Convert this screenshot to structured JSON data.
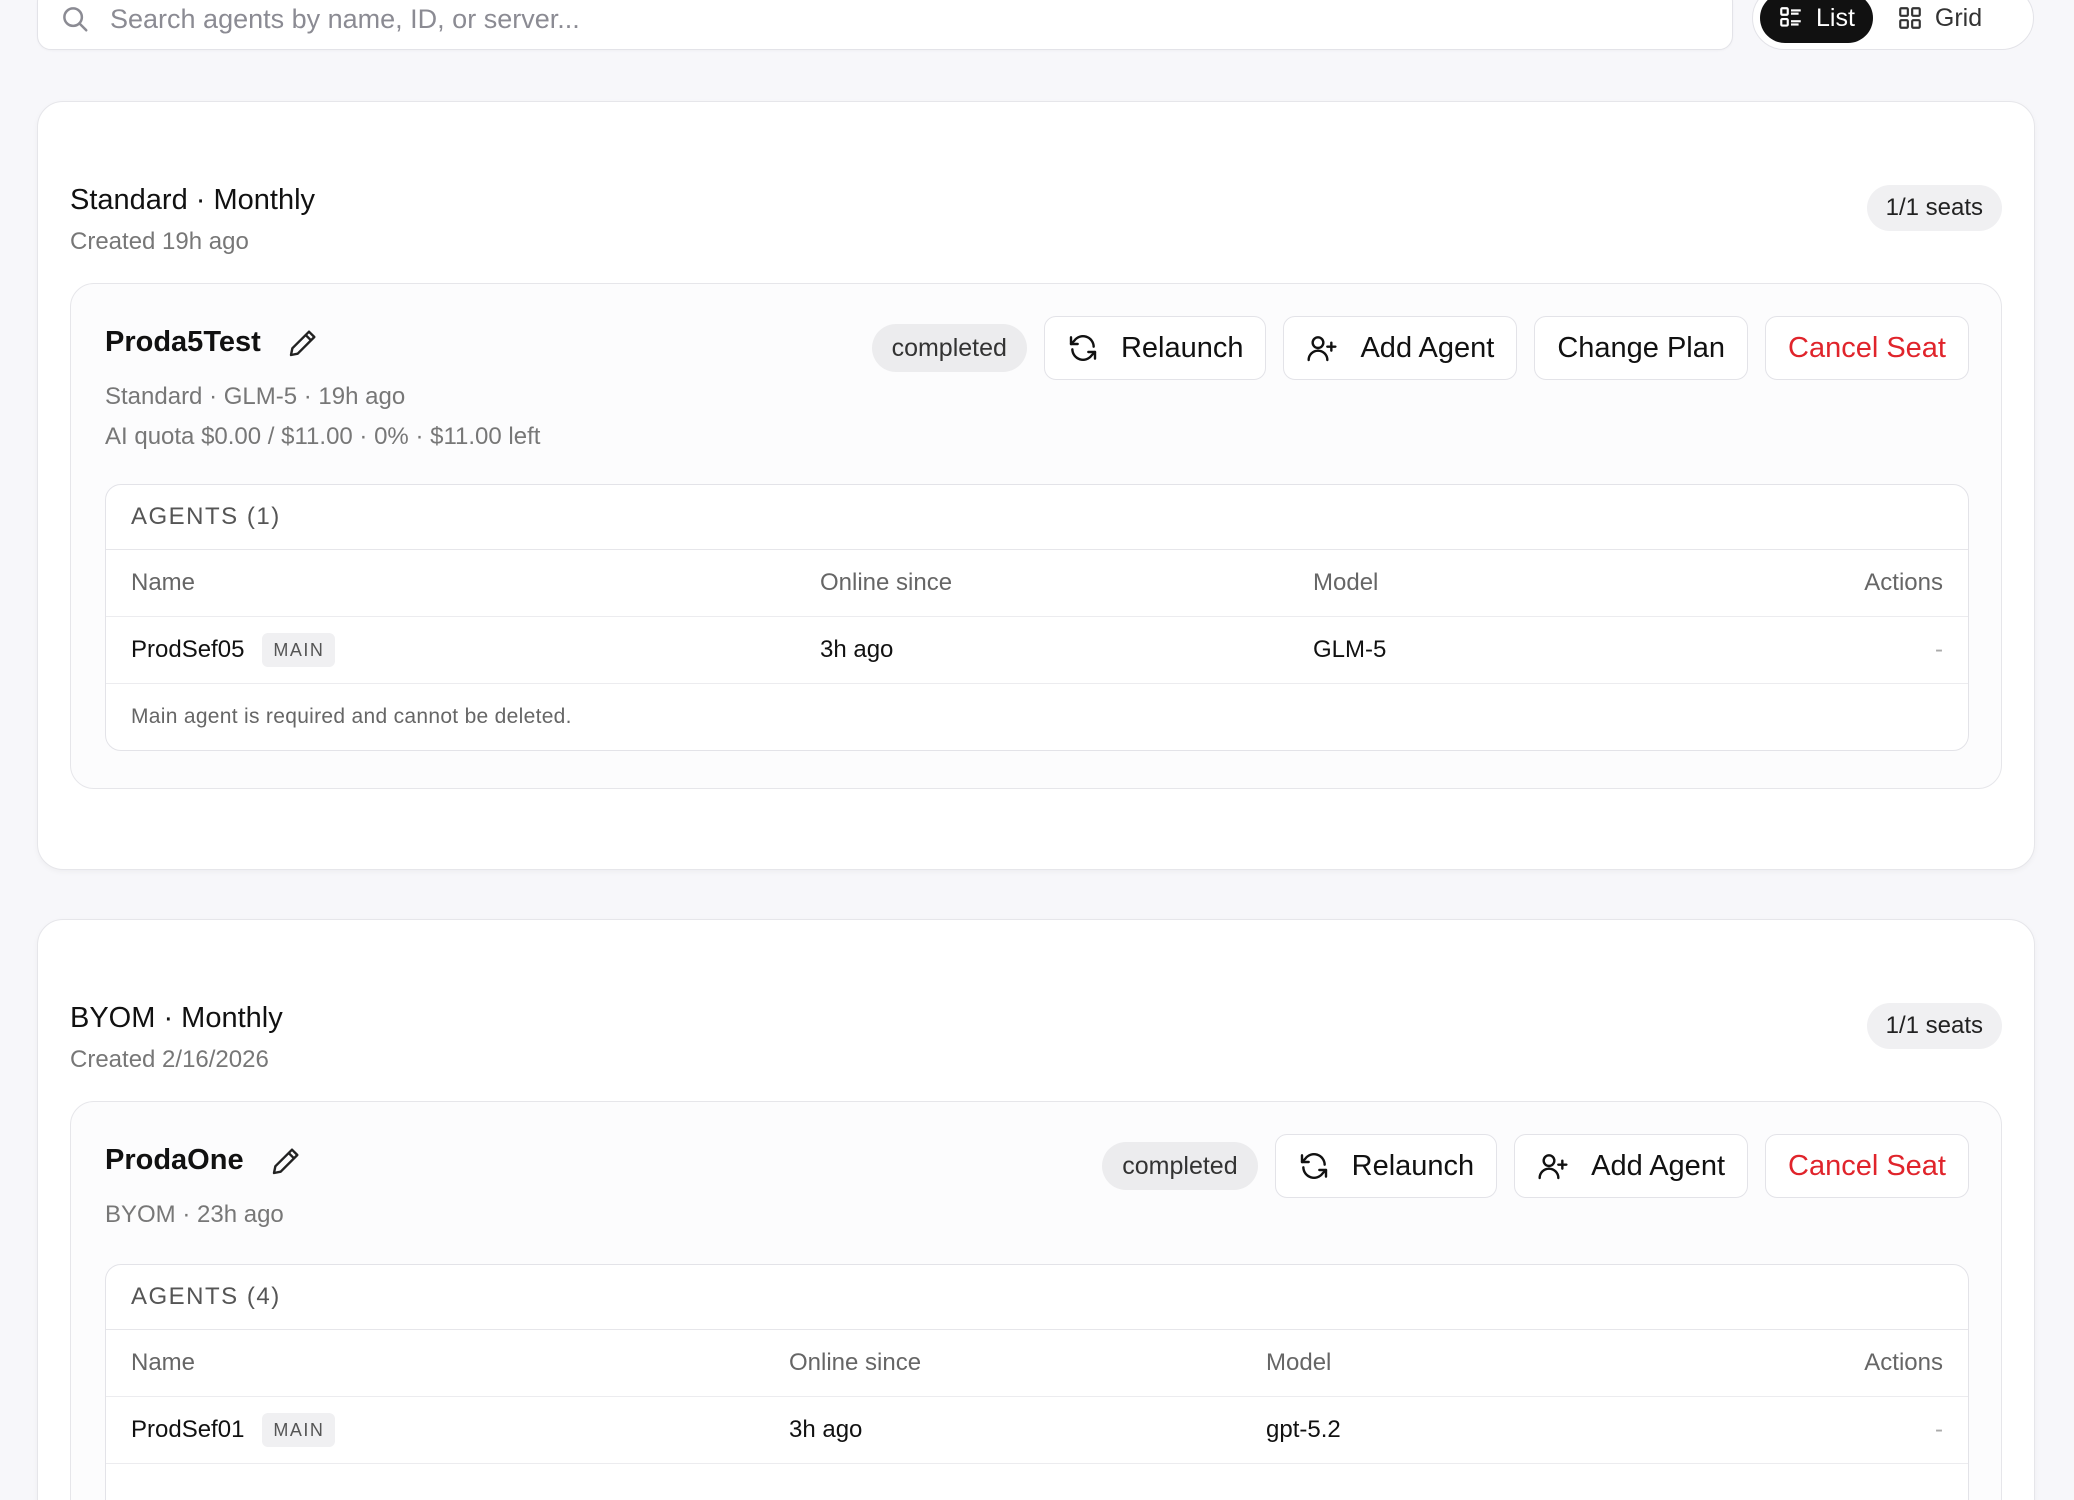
{
  "search": {
    "placeholder": "Search agents by name, ID, or server..."
  },
  "view_toggle": {
    "list_label": "List",
    "grid_label": "Grid",
    "active": "List"
  },
  "plans": [
    {
      "title": "Standard · Monthly",
      "created": "Created 19h ago",
      "seats": "1/1 seats",
      "seat": {
        "name": "Proda5Test",
        "meta_line1": "Standard · GLM-5 · 19h ago",
        "meta_line2": "AI quota $0.00 / $11.00 · 0% · $11.00 left",
        "status": "completed",
        "buttons": {
          "relaunch": "Relaunch",
          "add_agent": "Add Agent",
          "change_plan": "Change Plan",
          "cancel_seat": "Cancel Seat"
        },
        "agents_header": "AGENTS (1)",
        "columns": {
          "name": "Name",
          "online_since": "Online since",
          "model": "Model",
          "actions": "Actions"
        },
        "rows": [
          {
            "name": "ProdSef05",
            "badge": "MAIN",
            "online_since": "3h ago",
            "model": "GLM-5",
            "actions": "-"
          }
        ],
        "note": "Main agent is required and cannot be deleted."
      }
    },
    {
      "title": "BYOM · Monthly",
      "created": "Created 2/16/2026",
      "seats": "1/1 seats",
      "seat": {
        "name": "ProdaOne",
        "meta_line1": "BYOM · 23h ago",
        "status": "completed",
        "buttons": {
          "relaunch": "Relaunch",
          "add_agent": "Add Agent",
          "cancel_seat": "Cancel Seat"
        },
        "agents_header": "AGENTS (4)",
        "columns": {
          "name": "Name",
          "online_since": "Online since",
          "model": "Model",
          "actions": "Actions"
        },
        "rows": [
          {
            "name": "ProdSef01",
            "badge": "MAIN",
            "online_since": "3h ago",
            "model": "gpt-5.2",
            "actions": "-"
          }
        ]
      }
    }
  ],
  "colors": {
    "danger": "#e0242b",
    "toggle_active_bg": "#111111",
    "badge_bg": "#f0f0f2"
  },
  "icons": [
    "search-icon",
    "list-icon",
    "grid-icon",
    "pencil-icon",
    "refresh-icon",
    "user-plus-icon"
  ]
}
